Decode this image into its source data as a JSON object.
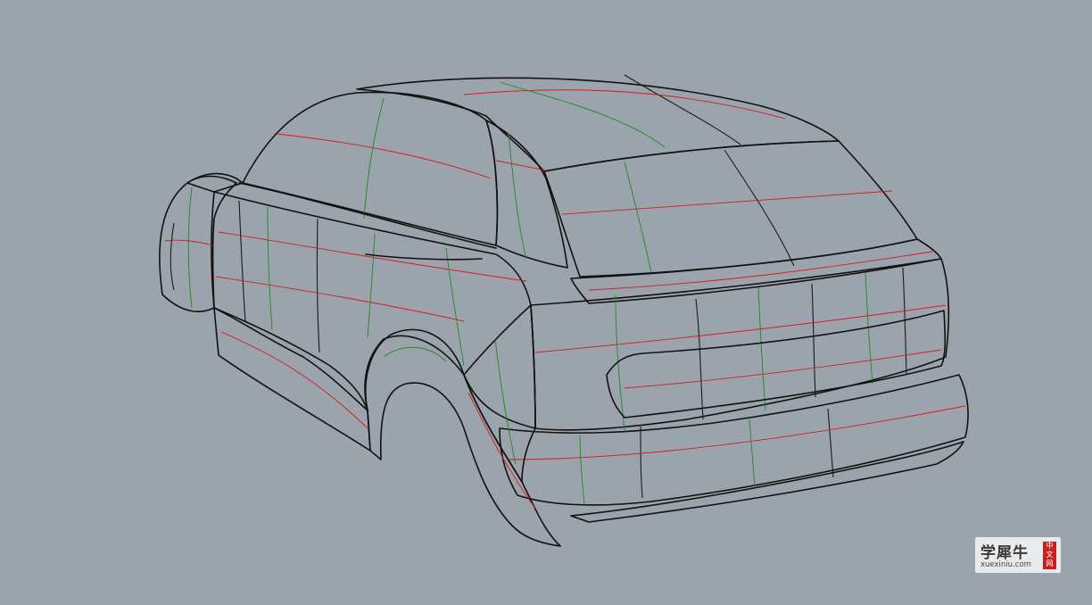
{
  "viewport": {
    "background": "#9ba3ac",
    "model": "car body surface wireframe with isoparametric curves",
    "isocurve_colors": {
      "u": "#d61c1c",
      "v": "#1f8a1f",
      "edge": "#111111"
    }
  },
  "watermark": {
    "title": "学犀牛",
    "url": "xuexiniu.com",
    "seal": "中文网"
  }
}
